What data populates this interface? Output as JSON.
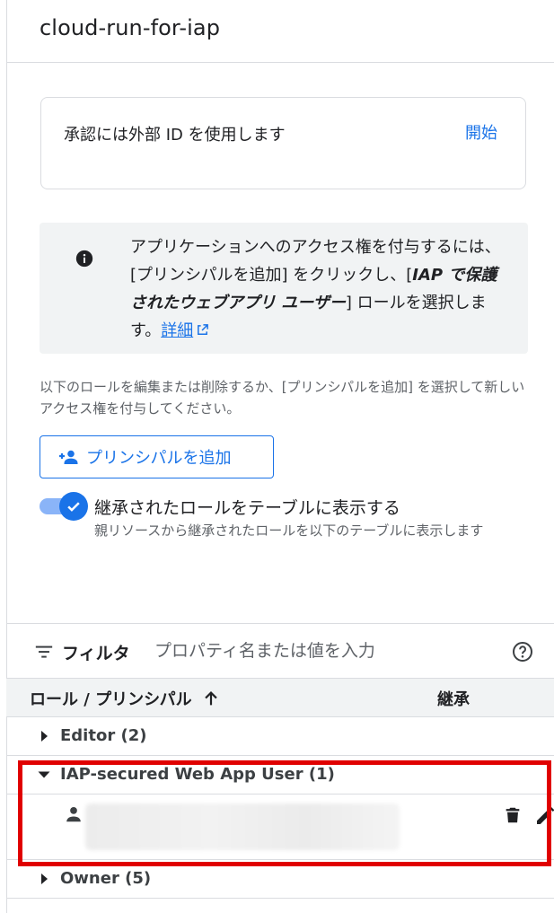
{
  "page": {
    "title": "cloud-run-for-iap"
  },
  "external_id": {
    "label": "承認には外部 ID を使用します",
    "start_link": "開始"
  },
  "info": {
    "text_before": "アプリケーションへのアクセス権を付与するには、[プリンシパルを追加] をクリックし、[",
    "role_name": "IAP で保護されたウェブアプリ ユーザー",
    "text_after": "] ロールを選択します。",
    "learn_more": "詳細"
  },
  "help_text": "以下のロールを編集または削除するか、[プリンシパルを追加] を選択して新しいアクセス権を付与してください。",
  "add_principal": {
    "label": "プリンシパルを追加"
  },
  "inherited_toggle": {
    "on": true,
    "label": "継承されたロールをテーブルに表示する",
    "description": "親リソースから継承されたロールを以下のテーブルに表示します"
  },
  "filter": {
    "label": "フィルタ",
    "placeholder": "プロパティ名または値を入力"
  },
  "table": {
    "columns": {
      "role_principal": "ロール / プリンシパル",
      "inherited": "継承"
    },
    "rows": [
      {
        "label": "Editor (2)",
        "expanded": false
      },
      {
        "label": "IAP-secured Web App User (1)",
        "expanded": true
      },
      {
        "label": "Owner (5)",
        "expanded": false
      }
    ]
  },
  "colors": {
    "accent": "#1a73e8",
    "highlight": "#e00000",
    "info_bg": "#f1f3f4"
  },
  "icons": [
    "info-icon",
    "external-link-icon",
    "add-person-icon",
    "check-icon",
    "filter-icon",
    "help-icon",
    "arrow-up-icon",
    "caret-right-icon",
    "caret-down-icon",
    "person-icon",
    "trash-icon",
    "edit-icon"
  ]
}
